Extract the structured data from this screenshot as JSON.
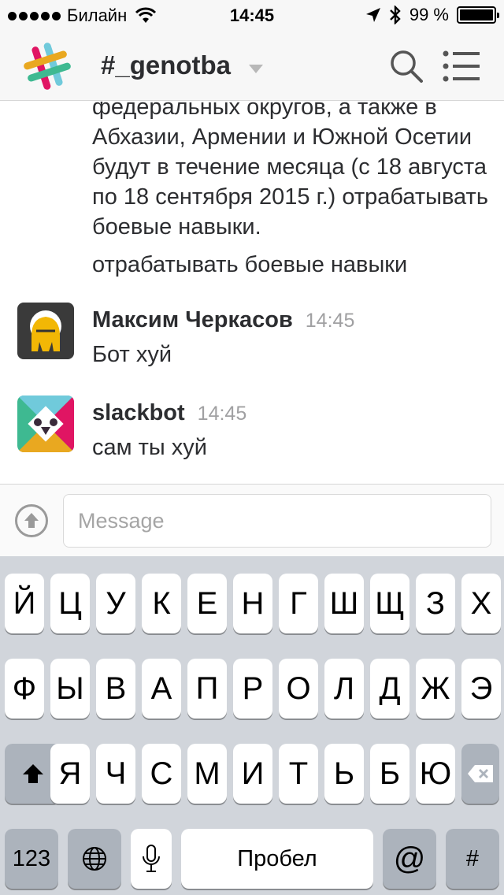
{
  "status_bar": {
    "carrier": "Билайн",
    "time": "14:45",
    "battery": "99 %",
    "battery_level": 0.99
  },
  "nav": {
    "channel": "#_genotba"
  },
  "messages": {
    "continuation_text": "федеральных округов, а также в Абхазии, Армении и Южной Осетии будут в течение месяца (с 18 августа по 18 сентября 2015 г.) отрабатывать боевые навыки.",
    "continuation_text_2": "отрабатывать боевые навыки",
    "items": [
      {
        "author": "Максим Черкасов",
        "time": "14:45",
        "text": "Бот хуй"
      },
      {
        "author": "slackbot",
        "time": "14:45",
        "text": "сам ты хуй"
      }
    ]
  },
  "composer": {
    "placeholder": "Message"
  },
  "keyboard": {
    "row1": [
      "Й",
      "Ц",
      "У",
      "К",
      "Е",
      "Н",
      "Г",
      "Ш",
      "Щ",
      "З",
      "Х"
    ],
    "row2": [
      "Ф",
      "Ы",
      "В",
      "А",
      "П",
      "Р",
      "О",
      "Л",
      "Д",
      "Ж",
      "Э"
    ],
    "row3": [
      "Я",
      "Ч",
      "С",
      "М",
      "И",
      "Т",
      "Ь",
      "Б",
      "Ю"
    ],
    "numbers_label": "123",
    "space_label": "Пробел",
    "at_label": "@",
    "hash_label": "#"
  },
  "colors": {
    "nav_bg": "#f7f7f7",
    "keyboard_bg": "#d1d5db",
    "timestamp": "#a0a0a2"
  }
}
